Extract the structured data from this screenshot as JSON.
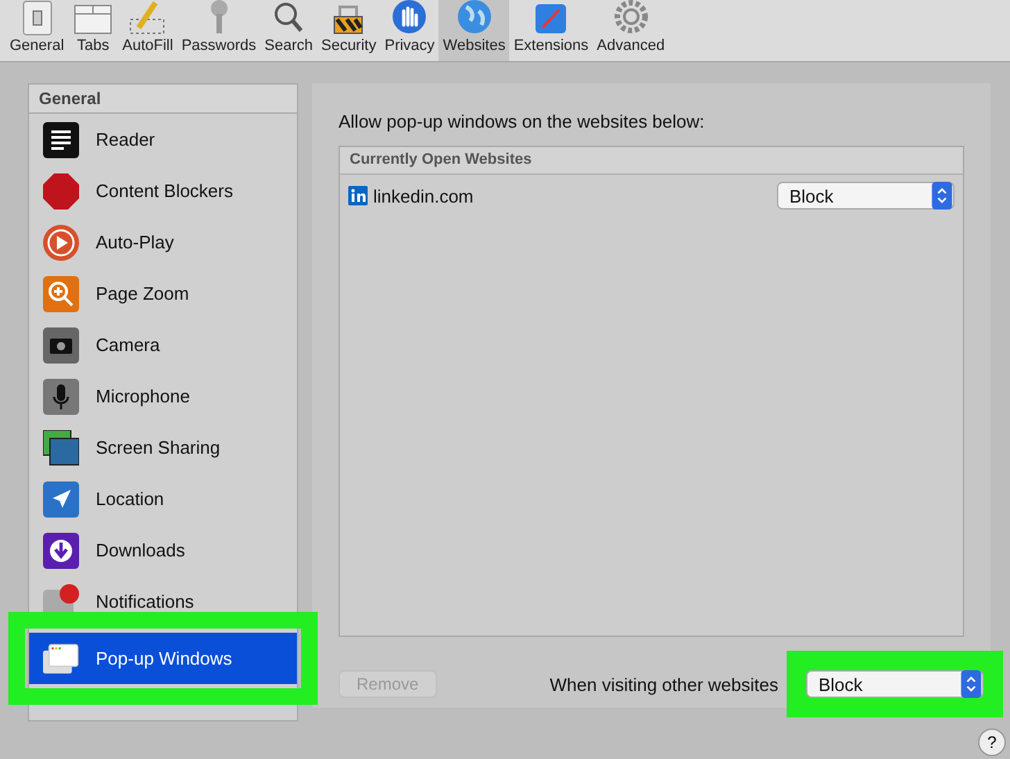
{
  "toolbar": {
    "tabs": [
      {
        "label": "General",
        "selected": false
      },
      {
        "label": "Tabs",
        "selected": false
      },
      {
        "label": "AutoFill",
        "selected": false
      },
      {
        "label": "Passwords",
        "selected": false
      },
      {
        "label": "Search",
        "selected": false
      },
      {
        "label": "Security",
        "selected": false
      },
      {
        "label": "Privacy",
        "selected": false
      },
      {
        "label": "Websites",
        "selected": true
      },
      {
        "label": "Extensions",
        "selected": false
      },
      {
        "label": "Advanced",
        "selected": false
      }
    ]
  },
  "sidebar": {
    "header": "General",
    "items": [
      {
        "label": "Reader",
        "selected": false,
        "highlighted": false
      },
      {
        "label": "Content Blockers",
        "selected": false,
        "highlighted": false
      },
      {
        "label": "Auto-Play",
        "selected": false,
        "highlighted": false
      },
      {
        "label": "Page Zoom",
        "selected": false,
        "highlighted": false
      },
      {
        "label": "Camera",
        "selected": false,
        "highlighted": false
      },
      {
        "label": "Microphone",
        "selected": false,
        "highlighted": false
      },
      {
        "label": "Screen Sharing",
        "selected": false,
        "highlighted": false
      },
      {
        "label": "Location",
        "selected": false,
        "highlighted": false
      },
      {
        "label": "Downloads",
        "selected": false,
        "highlighted": false
      },
      {
        "label": "Notifications",
        "selected": false,
        "highlighted": false
      },
      {
        "label": "Pop-up Windows",
        "selected": true,
        "highlighted": true
      }
    ]
  },
  "main": {
    "prompt": "Allow pop-up windows on the websites below:",
    "table": {
      "header": "Currently Open Websites",
      "rows": [
        {
          "site": "linkedin.com",
          "setting": "Block"
        }
      ]
    },
    "remove_button": {
      "label": "Remove",
      "disabled": true
    },
    "default_label": "When visiting other websites",
    "default_select": {
      "value": "Block",
      "highlighted": true
    },
    "help_button": "?"
  }
}
